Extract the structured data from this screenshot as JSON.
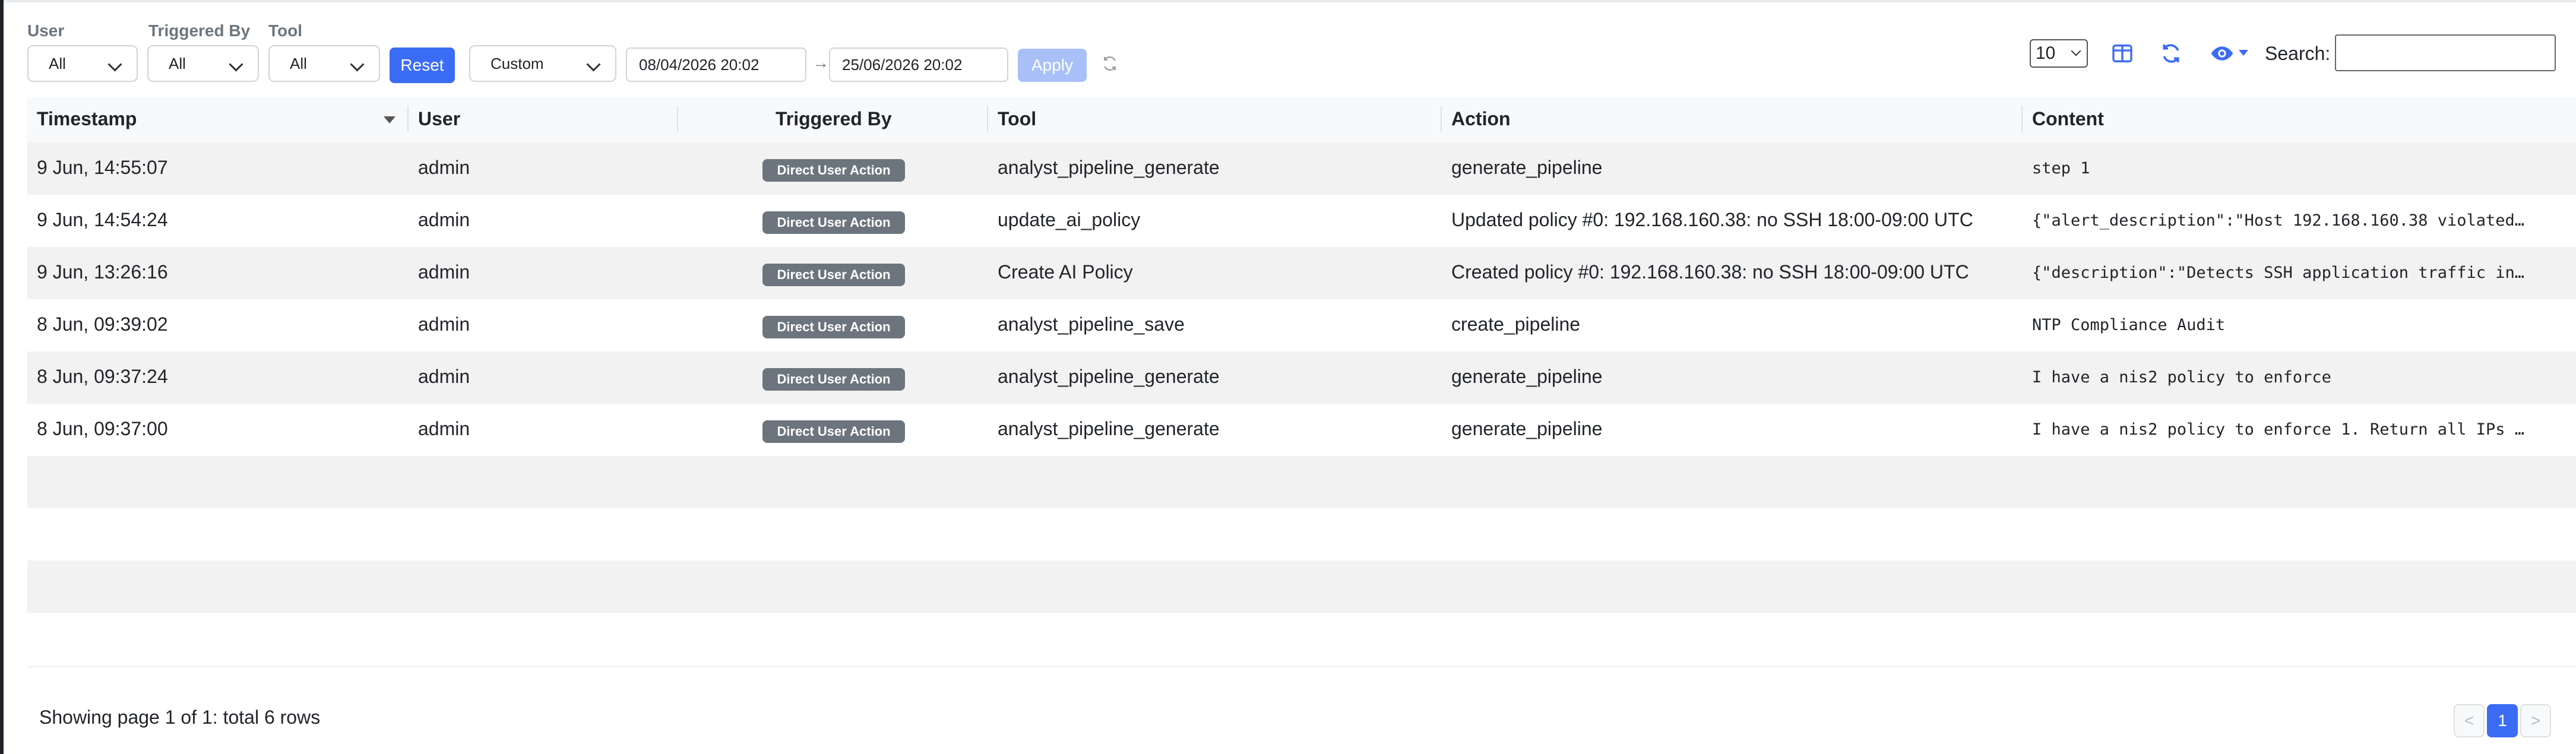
{
  "filters": {
    "user_label": "User",
    "triggered_by_label": "Triggered By",
    "tool_label": "Tool",
    "user_value": "All",
    "triggered_by_value": "All",
    "tool_value": "All",
    "reset_label": "Reset",
    "range_value": "Custom",
    "date_from": "08/04/2026 20:02",
    "date_arrow": "→",
    "date_to": "25/06/2026 20:02",
    "apply_label": "Apply"
  },
  "toolbar": {
    "page_size": "10",
    "search_label": "Search:",
    "search_value": ""
  },
  "table": {
    "headers": {
      "timestamp": "Timestamp",
      "user": "User",
      "triggered_by": "Triggered By",
      "tool": "Tool",
      "action": "Action",
      "content": "Content"
    },
    "rows": [
      {
        "timestamp": "9 Jun, 14:55:07",
        "user": "admin",
        "triggered_by": "Direct User Action",
        "tool": "analyst_pipeline_generate",
        "action": "generate_pipeline",
        "content": "step 1"
      },
      {
        "timestamp": "9 Jun, 14:54:24",
        "user": "admin",
        "triggered_by": "Direct User Action",
        "tool": "update_ai_policy",
        "action": "Updated policy #0: 192.168.160.38: no SSH 18:00-09:00 UTC",
        "content": "{\"alert_description\":\"Host 192.168.160.38 violated…"
      },
      {
        "timestamp": "9 Jun, 13:26:16",
        "user": "admin",
        "triggered_by": "Direct User Action",
        "tool": "Create AI Policy",
        "action": "Created policy #0: 192.168.160.38: no SSH 18:00-09:00 UTC",
        "content": "{\"description\":\"Detects SSH application traffic in…"
      },
      {
        "timestamp": "8 Jun, 09:39:02",
        "user": "admin",
        "triggered_by": "Direct User Action",
        "tool": "analyst_pipeline_save",
        "action": "create_pipeline",
        "content": "NTP Compliance Audit"
      },
      {
        "timestamp": "8 Jun, 09:37:24",
        "user": "admin",
        "triggered_by": "Direct User Action",
        "tool": "analyst_pipeline_generate",
        "action": "generate_pipeline",
        "content": "I have a nis2 policy to enforce"
      },
      {
        "timestamp": "8 Jun, 09:37:00",
        "user": "admin",
        "triggered_by": "Direct User Action",
        "tool": "analyst_pipeline_generate",
        "action": "generate_pipeline",
        "content": "I have a nis2 policy to enforce 1. Return all IPs …"
      }
    ]
  },
  "footer": {
    "summary": "Showing page 1 of 1: total 6 rows",
    "prev": "<",
    "current_page": "1",
    "next": ">"
  },
  "colors": {
    "accent": "#3b6cf6",
    "badge": "#6c757d",
    "stripe": "#f2f2f2"
  }
}
